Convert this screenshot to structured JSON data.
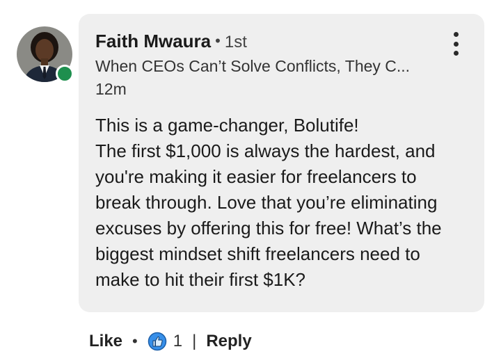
{
  "comment": {
    "author_name": "Faith Mwaura",
    "degree_separator": "•",
    "degree": "1st",
    "headline": "When CEOs Can’t Solve Conflicts, They C...",
    "timestamp": "12m",
    "body_lines": [
      "This is a game-changer, Bolutife!",
      "The first $1,000 is always the hardest, and",
      "you're making it easier for freelancers to",
      "break through. Love that you’re eliminating",
      "excuses by offering this for free! What’s the",
      "biggest mindset shift freelancers need to",
      "make to hit their first $1K?"
    ],
    "online": true,
    "more_icon": "three-dots-vertical-icon"
  },
  "actions": {
    "like_label": "Like",
    "dot": "•",
    "reaction_icon": "like-thumb-icon",
    "reaction_count": "1",
    "separator": "|",
    "reply_label": "Reply"
  },
  "colors": {
    "bubble_bg": "#efefef",
    "online_green": "#1e8f4e",
    "like_blue": "#378fe9"
  }
}
